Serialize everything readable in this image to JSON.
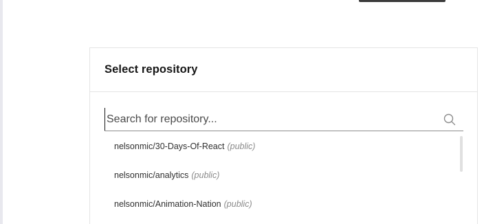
{
  "dialog": {
    "title": "Select repository"
  },
  "search": {
    "placeholder": "Search for repository..."
  },
  "repositories": [
    {
      "name": "nelsonmic/30-Days-Of-React",
      "visibility": "(public)"
    },
    {
      "name": "nelsonmic/analytics",
      "visibility": "(public)"
    },
    {
      "name": "nelsonmic/Animation-Nation",
      "visibility": "(public)"
    }
  ],
  "icons": {
    "search": "search-icon"
  },
  "colors": {
    "text": "#161616",
    "muted": "#8a8a8a",
    "border": "#e4e4e4"
  }
}
